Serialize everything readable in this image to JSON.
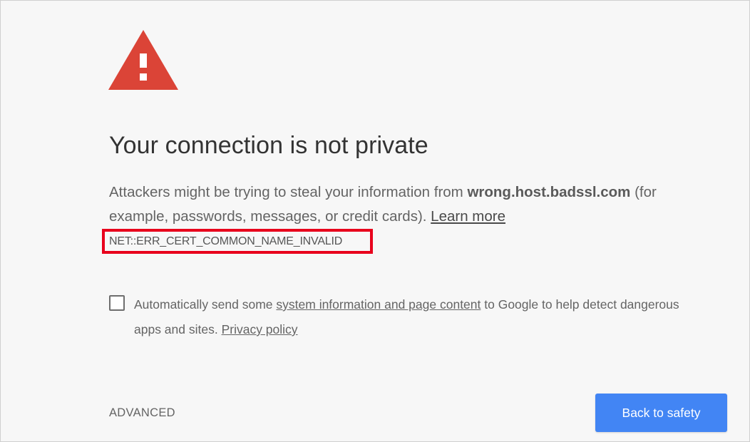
{
  "icon": {
    "name": "warning-triangle-icon",
    "color": "#db4437"
  },
  "title": "Your connection is not private",
  "message": {
    "prefix": "Attackers might be trying to steal your information from ",
    "host": "wrong.host.badssl.com",
    "suffix": " (for example, passwords, messages, or credit cards). ",
    "learn_more": "Learn more"
  },
  "error_code": "NET::ERR_CERT_COMMON_NAME_INVALID",
  "error_highlight_color": "#e8001c",
  "opt_in": {
    "checked": false,
    "prefix": "Automatically send some ",
    "link": "system information and page content",
    "middle": " to Google to help detect dangerous apps and sites. ",
    "privacy_link": "Privacy policy"
  },
  "advanced_label": "ADVANCED",
  "back_button_label": "Back to safety",
  "primary_color": "#4285f4"
}
